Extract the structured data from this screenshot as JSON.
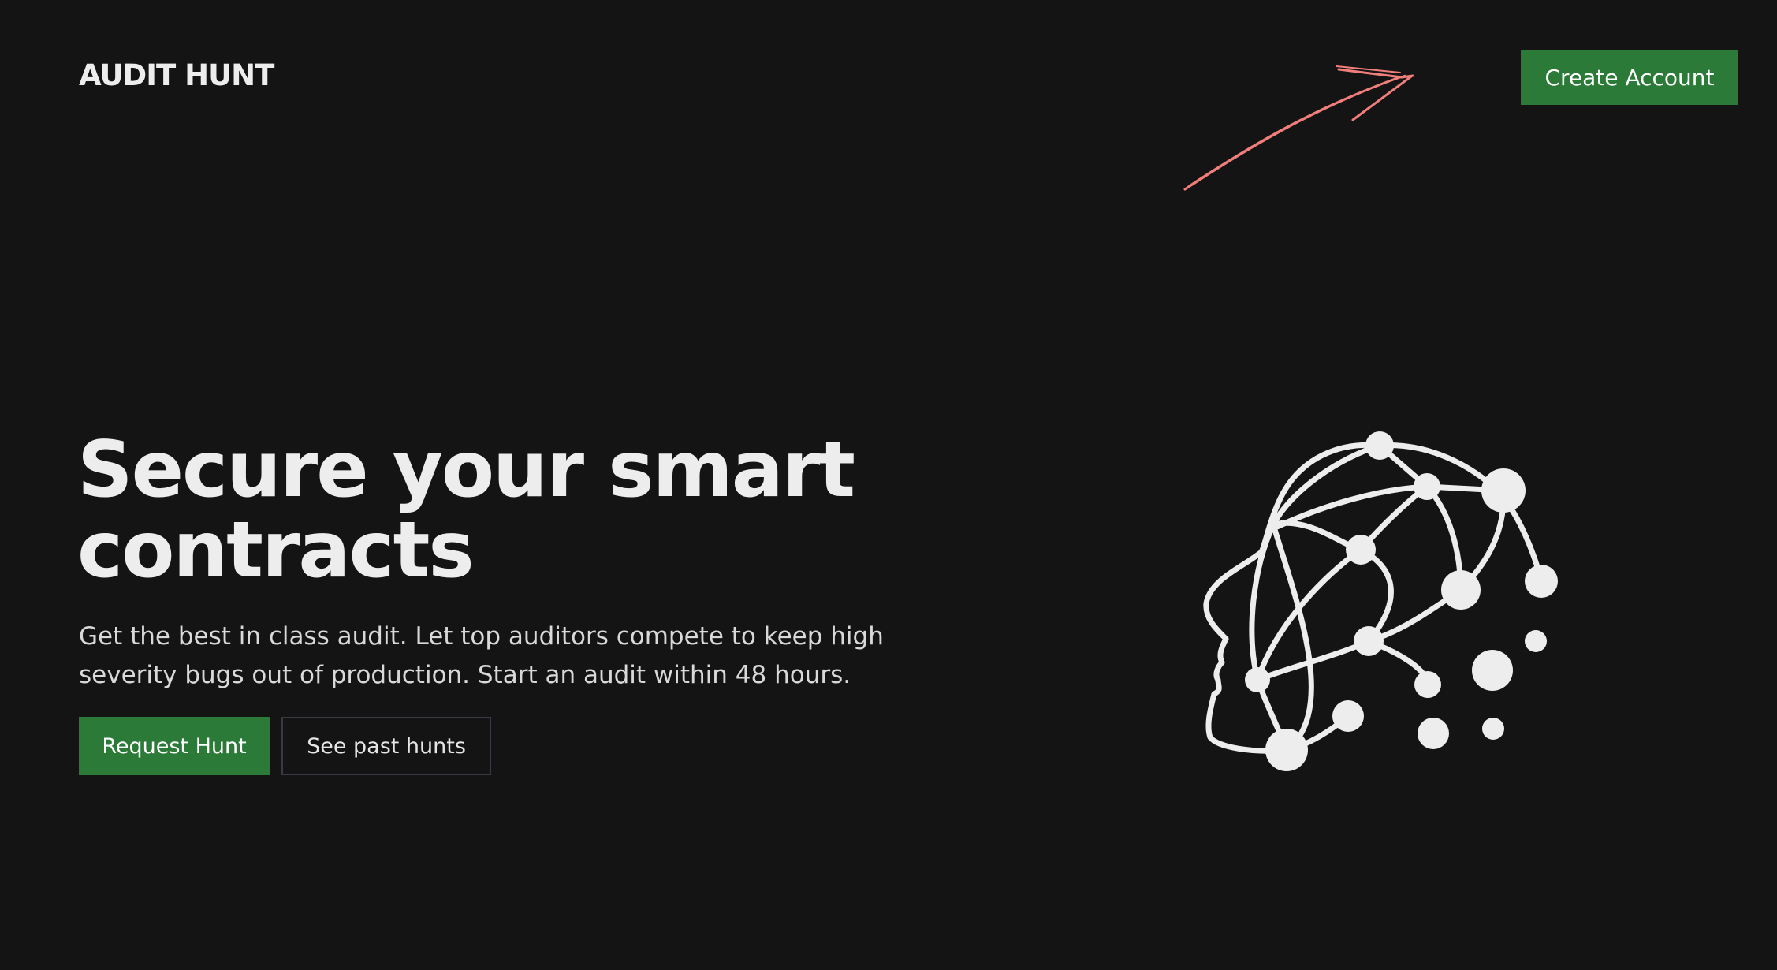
{
  "header": {
    "logo_text": "AUDIT HUNT",
    "create_account_label": "Create Account"
  },
  "hero": {
    "title_line1": "Secure your smart",
    "title_line2": "contracts",
    "subtitle_line1": "Get the best in class audit. Let top auditors compete to keep high",
    "subtitle_line2": "severity bugs out of production. Start an audit within 48 hours.",
    "primary_button_label": "Request Hunt",
    "secondary_button_label": "See past hunts"
  },
  "illustration": {
    "icon": "network-head-icon"
  },
  "annotation": {
    "icon": "hand-drawn-arrow-icon",
    "color": "#f07f7b"
  },
  "colors": {
    "background": "#141414",
    "accent_green": "#2b7a38",
    "text": "#ededed"
  }
}
